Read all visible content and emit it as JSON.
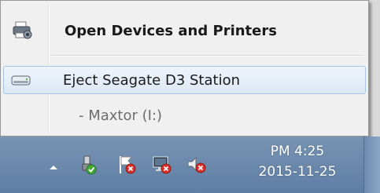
{
  "menu": {
    "items": [
      {
        "label": "Open Devices and Printers",
        "icon": "devices-printer-icon"
      },
      {
        "label": "Eject Seagate D3 Station",
        "icon": "external-drive-icon"
      },
      {
        "label": "- Maxtor (I:)"
      }
    ]
  },
  "taskbar": {
    "icons": [
      "show-hidden-icons-chevron",
      "safely-remove-hardware-icon",
      "action-center-flag-icon",
      "network-disconnected-icon",
      "volume-muted-icon"
    ],
    "clock_time": "PM 4:25",
    "clock_date": "2015-11-25"
  }
}
